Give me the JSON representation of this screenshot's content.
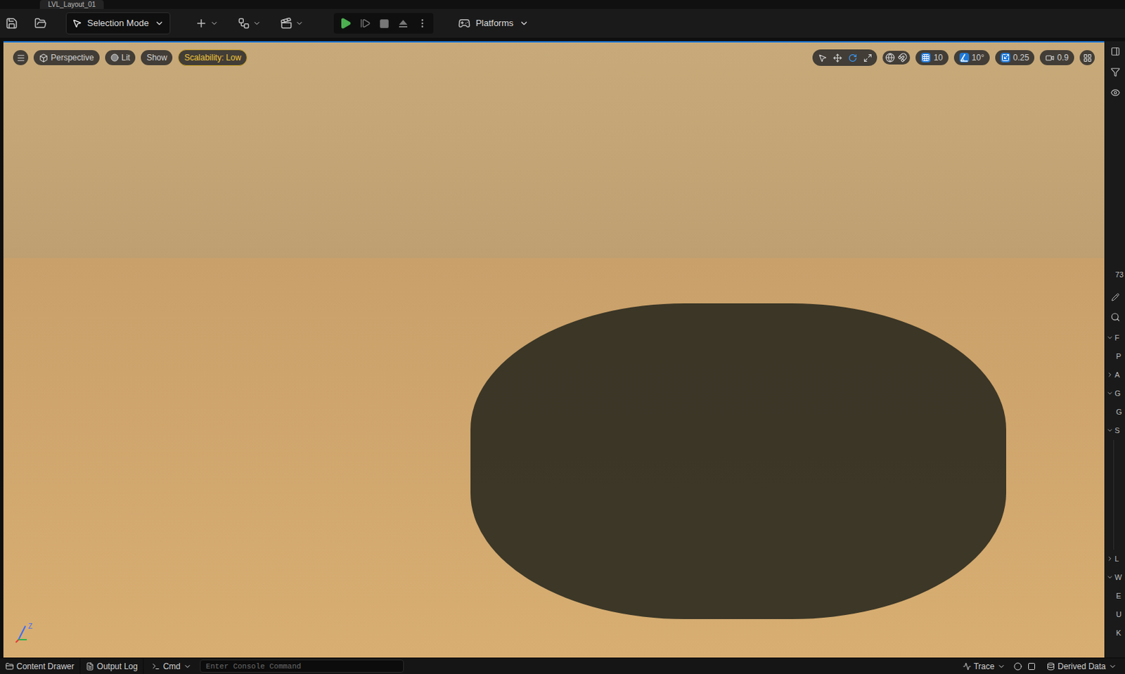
{
  "window": {
    "tab": "LVL_Layout_01"
  },
  "toolbar": {
    "mode": "Selection Mode",
    "platforms": "Platforms"
  },
  "viewport": {
    "view": "Perspective",
    "lighting": "Lit",
    "show": "Show",
    "scalability": "Scalability: Low",
    "transform_tools": [
      {
        "tool": "select",
        "selected": false
      },
      {
        "tool": "translate",
        "selected": false
      },
      {
        "tool": "rotate",
        "selected": true
      },
      {
        "tool": "scale",
        "selected": false
      }
    ],
    "grid_snap": "10",
    "rotation_snap": "10°",
    "scale_snap": "0.25",
    "camera_speed": "0.9",
    "axis_label": "Z"
  },
  "details_panel": {
    "count": "73",
    "sections": [
      {
        "label": "F",
        "expanded": true,
        "items": [
          "P"
        ]
      },
      {
        "label": "A",
        "expanded": false,
        "items": []
      },
      {
        "label": "G",
        "expanded": true,
        "items": [
          "G"
        ]
      },
      {
        "label": "S",
        "expanded": true,
        "items": []
      },
      {
        "label": "L",
        "expanded": false,
        "items": []
      },
      {
        "label": "W",
        "expanded": true,
        "items": [
          "E",
          "U",
          "K"
        ]
      }
    ]
  },
  "status_bar": {
    "items": [
      "Content Drawer",
      "Output Log"
    ],
    "cmd": "Cmd",
    "console_placeholder": "Enter Console Command",
    "trace": "Trace",
    "derived_data": "Derived Data"
  }
}
